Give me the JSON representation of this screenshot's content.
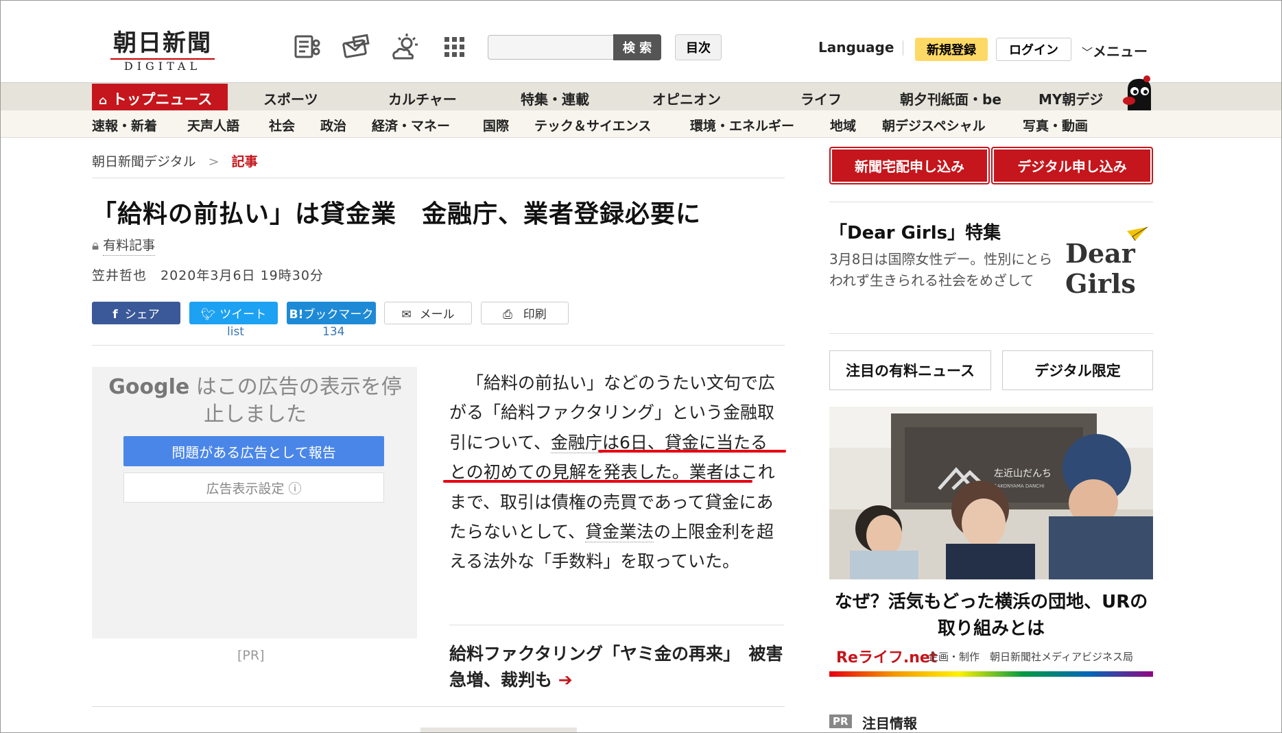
{
  "header": {
    "logo_main": "朝日新聞",
    "logo_sub": "DIGITAL",
    "search_placeholder": "",
    "search_label": "検 索",
    "toc_label": "目次",
    "language_label": "Language",
    "register_label": "新規登録",
    "login_label": "ログイン",
    "menu_label": "メニュー",
    "icons": [
      "newspaper-icon",
      "mail-card-icon",
      "weather-icon",
      "grid-icon"
    ]
  },
  "nav_primary": {
    "active": "トップニュース",
    "items": [
      "スポーツ",
      "カルチャー",
      "特集・連載",
      "オピニオン",
      "ライフ",
      "朝夕刊紙面・be",
      "MY朝デジ"
    ]
  },
  "nav_secondary": {
    "items": [
      "速報・新着",
      "天声人語",
      "社会",
      "政治",
      "経済・マネー",
      "国際",
      "テック＆サイエンス",
      "環境・エネルギー",
      "地域",
      "朝デジスペシャル",
      "写真・動画"
    ]
  },
  "breadcrumb": {
    "home": "朝日新聞デジタル",
    "sep": ">",
    "current": "記事"
  },
  "article": {
    "title": "「給料の前払い」は貸金業　金融庁、業者登録必要に",
    "paid_label": "有料記事",
    "byline": "笠井哲也　2020年3月6日 19時30分",
    "share": {
      "facebook": "シェア",
      "twitter": "ツイート",
      "hatena": "ブックマーク",
      "hatena_prefix": "B!",
      "mail": "メール",
      "print": "印刷",
      "twitter_count": "list",
      "hatena_count": "134"
    },
    "body": {
      "p1": "「給料の前払い」などのうたい文句で広がる「給料ファクタリング」という金融取引について、",
      "link1": "金融庁",
      "p2": "は6日、貸金に当たるとの初めての見解を発表した。業者はこれまで、取引は債権の売買であって貸金にあたらないとして、",
      "link2": "貸金業法",
      "p3": "の上限金利を超える法外な「手数料」を取っていた。"
    },
    "related": "給料ファクタリング「ヤミ金の再来」　被害急増、裁判も",
    "related_arrow": "➔"
  },
  "ad": {
    "google": "Google",
    "message": "はこの広告の表示を停止しました",
    "report": "問題がある広告として報告",
    "settings": "広告表示設定 ⓘ",
    "pr": "[PR]"
  },
  "sidebar": {
    "btn_delivery": "新聞宅配申し込み",
    "btn_digital": "デジタル申し込み",
    "feature_title": "「Dear Girls」特集",
    "feature_text": "3月8日は国際女性デー。性別にとらわれず生きられる社会をめざして",
    "feature_logo_1": "Dear",
    "feature_logo_2": "Girls",
    "tab1": "注目の有料ニュース",
    "tab2": "デジタル限定",
    "photo_sign": "左近山だんち",
    "photo_sign_sub": "SAKONYAMA DANCHI",
    "caption": "なぜ？活気もどった横浜の団地、URの取り組みとは",
    "relife": "Reライフ.net",
    "relife_sub": "企画・制作　朝日新聞社メディアビジネス局",
    "notice_pr": "PR",
    "notice": "注目情報"
  },
  "colors": {
    "accent_red": "#c4161c",
    "highlight_red": "#e60012",
    "nav_bg": "#e6e3da",
    "register_yellow": "#ffd966"
  }
}
